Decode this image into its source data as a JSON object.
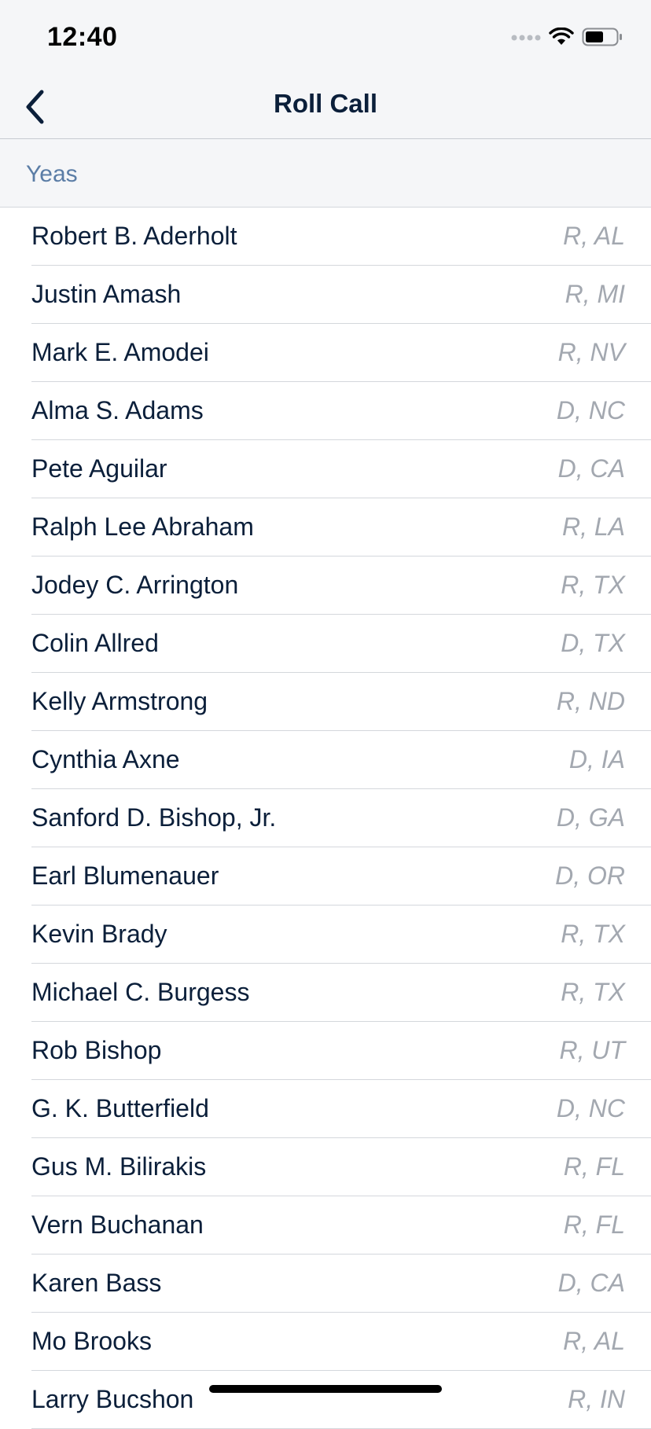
{
  "status_bar": {
    "time": "12:40",
    "icons": [
      "signal-dots-icon",
      "wifi-icon",
      "battery-icon"
    ]
  },
  "nav": {
    "title": "Roll Call",
    "back_icon": "chevron-left-icon"
  },
  "section": {
    "label": "Yeas"
  },
  "members": [
    {
      "name": "Robert B. Aderholt",
      "party": "R, AL"
    },
    {
      "name": "Justin Amash",
      "party": "R, MI"
    },
    {
      "name": "Mark E. Amodei",
      "party": "R, NV"
    },
    {
      "name": "Alma S. Adams",
      "party": "D, NC"
    },
    {
      "name": "Pete Aguilar",
      "party": "D, CA"
    },
    {
      "name": "Ralph Lee Abraham",
      "party": "R, LA"
    },
    {
      "name": "Jodey C. Arrington",
      "party": "R, TX"
    },
    {
      "name": "Colin Allred",
      "party": "D, TX"
    },
    {
      "name": "Kelly Armstrong",
      "party": "R, ND"
    },
    {
      "name": "Cynthia Axne",
      "party": "D, IA"
    },
    {
      "name": "Sanford D. Bishop, Jr.",
      "party": "D, GA"
    },
    {
      "name": "Earl Blumenauer",
      "party": "D, OR"
    },
    {
      "name": "Kevin Brady",
      "party": "R, TX"
    },
    {
      "name": "Michael C. Burgess",
      "party": "R, TX"
    },
    {
      "name": "Rob Bishop",
      "party": "R, UT"
    },
    {
      "name": "G. K. Butterfield",
      "party": "D, NC"
    },
    {
      "name": "Gus M. Bilirakis",
      "party": "R, FL"
    },
    {
      "name": "Vern Buchanan",
      "party": "R, FL"
    },
    {
      "name": "Karen Bass",
      "party": "D, CA"
    },
    {
      "name": "Mo Brooks",
      "party": "R, AL"
    },
    {
      "name": "Larry Bucshon",
      "party": "R, IN"
    }
  ],
  "colors": {
    "bar_background": "#f5f6f8",
    "name_text": "#0b1f3a",
    "party_text": "#a3a8b0",
    "section_label": "#5b7da6",
    "separator": "#d4d7dc"
  }
}
